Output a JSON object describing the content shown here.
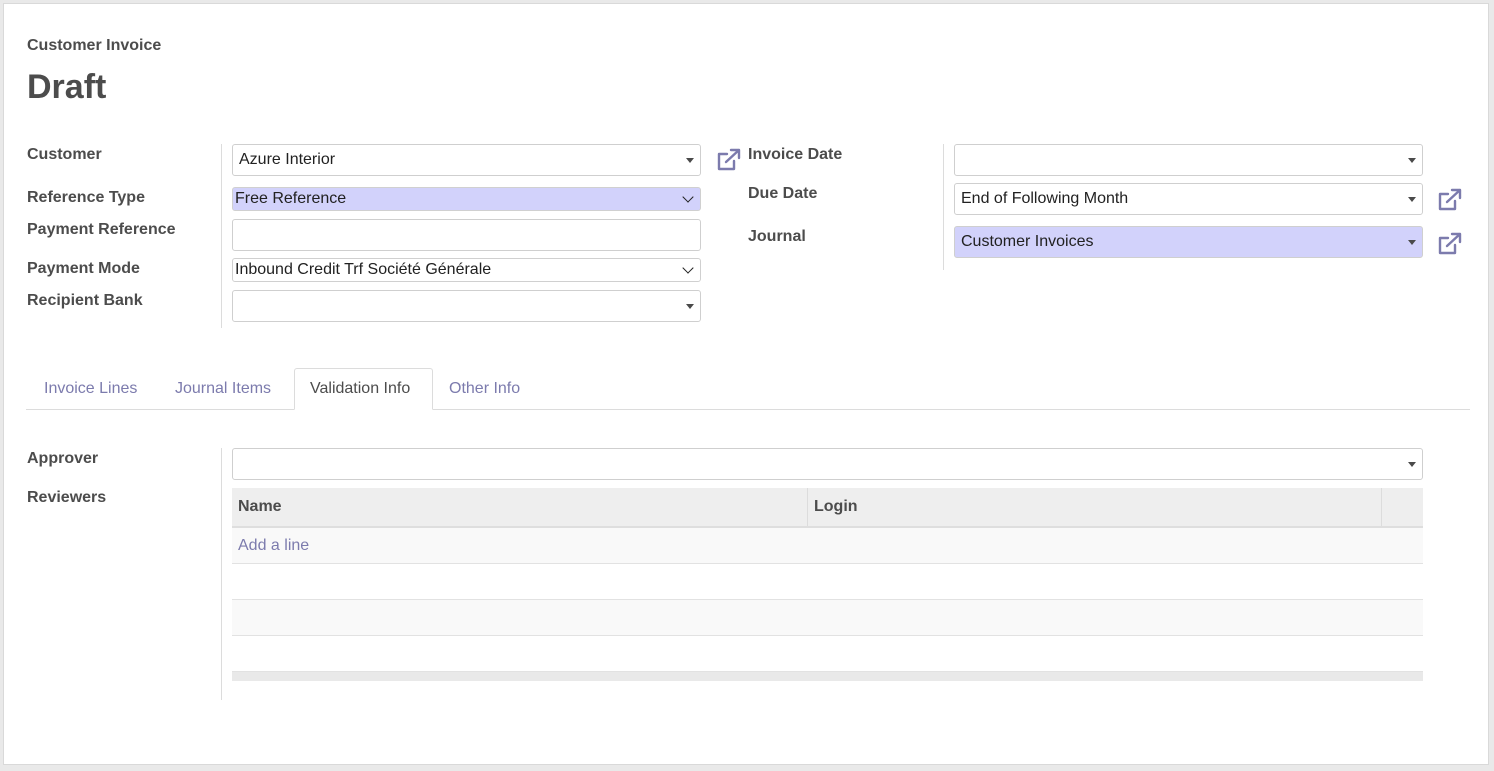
{
  "header": {
    "subtitle": "Customer Invoice",
    "title": "Draft"
  },
  "left_group": {
    "customer": {
      "label": "Customer",
      "value": "Azure Interior"
    },
    "reference_type": {
      "label": "Reference Type",
      "value": "Free Reference"
    },
    "payment_reference": {
      "label": "Payment Reference",
      "value": ""
    },
    "payment_mode": {
      "label": "Payment Mode",
      "value": "Inbound Credit Trf Société Générale"
    },
    "recipient_bank": {
      "label": "Recipient Bank",
      "value": ""
    }
  },
  "right_group": {
    "invoice_date": {
      "label": "Invoice Date",
      "value": ""
    },
    "due_date": {
      "label": "Due Date",
      "value": "End of Following Month"
    },
    "journal": {
      "label": "Journal",
      "value": "Customer Invoices"
    }
  },
  "tabs": [
    {
      "label": "Invoice Lines",
      "active": false
    },
    {
      "label": "Journal Items",
      "active": false
    },
    {
      "label": "Validation Info",
      "active": true
    },
    {
      "label": "Other Info",
      "active": false
    }
  ],
  "validation": {
    "approver": {
      "label": "Approver",
      "value": ""
    },
    "reviewers": {
      "label": "Reviewers",
      "columns": [
        "Name",
        "Login"
      ],
      "add_line": "Add a line"
    }
  },
  "icons": {
    "external_link": "external-link-icon",
    "dropdown": "caret-down-icon"
  },
  "colors": {
    "accent": "#7c7bad",
    "highlight_field": "#d2d2fb"
  }
}
